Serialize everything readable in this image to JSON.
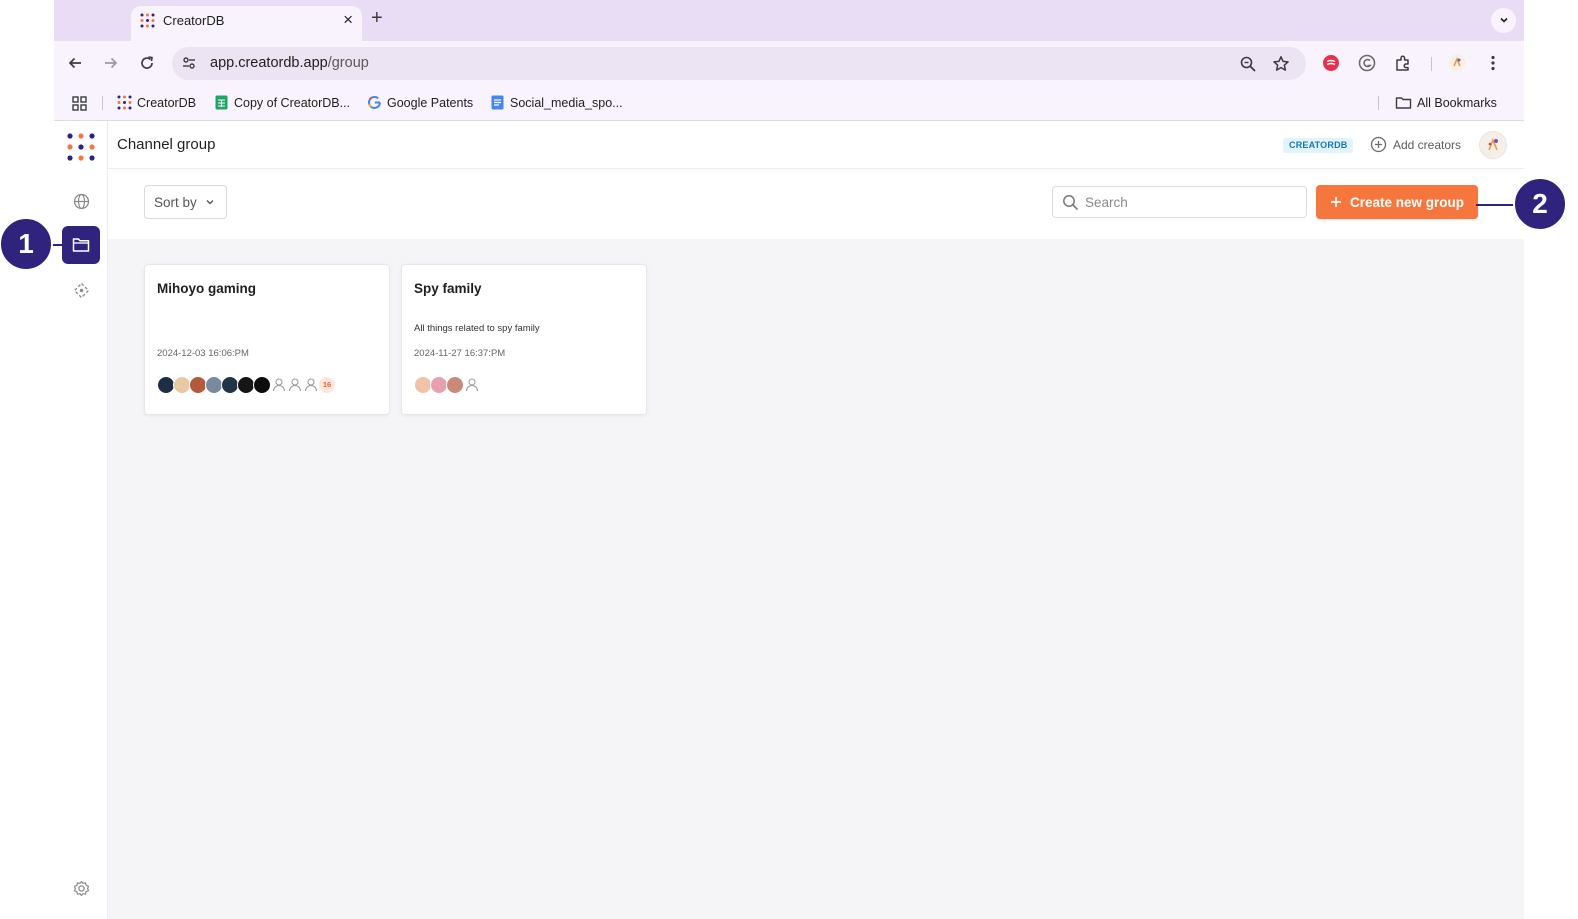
{
  "browser": {
    "tab_title": "CreatorDB",
    "tab_close_glyph": "×",
    "new_tab_glyph": "+",
    "url_host": "app.creatordb.app",
    "url_path": "/group",
    "bookmarks": [
      {
        "label": "CreatorDB",
        "icon": "creatordb-icon"
      },
      {
        "label": "Copy of CreatorDB...",
        "icon": "google-sheets-icon"
      },
      {
        "label": "Google Patents",
        "icon": "google-icon"
      },
      {
        "label": "Social_media_spo...",
        "icon": "google-docs-icon"
      }
    ],
    "all_bookmarks_label": "All Bookmarks"
  },
  "header": {
    "page_title": "Channel group",
    "badge": "CREATORDB",
    "add_creators_label": "Add creators"
  },
  "controls": {
    "sort_label": "Sort by",
    "search_placeholder": "Search",
    "create_button_label": "Create new group"
  },
  "groups": [
    {
      "title": "Mihoyo gaming",
      "description": "",
      "date": "2024-12-03 16:06:PM",
      "extra_count": "16"
    },
    {
      "title": "Spy family",
      "description": "All things related to spy family",
      "date": "2024-11-27 16:37:PM",
      "extra_count": ""
    }
  ],
  "callouts": [
    "1",
    "2"
  ],
  "colors": {
    "accent_orange": "#f5773d",
    "brand_indigo": "#2f237e",
    "badge_bg": "#e3f3fb",
    "badge_text": "#1778b7"
  }
}
